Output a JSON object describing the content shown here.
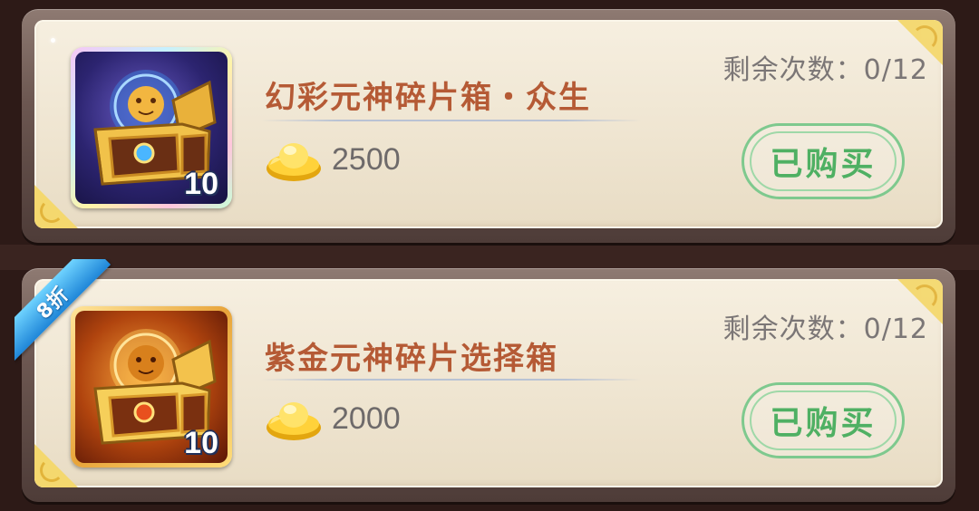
{
  "items": [
    {
      "title": "幻彩元神碎片箱・众生",
      "quantity": "10",
      "price": "2500",
      "remaining": "剩余次数：0/12",
      "button_label": "已购买",
      "icon": "rainbow-treasure-chest-icon",
      "discount": null
    },
    {
      "title": "紫金元神碎片选择箱",
      "quantity": "10",
      "price": "2000",
      "remaining": "剩余次数：0/12",
      "button_label": "已购买",
      "icon": "golden-treasure-chest-icon",
      "discount": "8折"
    }
  ],
  "currency_icon": "gold-ingot-icon",
  "colors": {
    "title": "#b55a35",
    "purchased": "#4fb063",
    "discount_ribbon": "#2c95e0"
  }
}
